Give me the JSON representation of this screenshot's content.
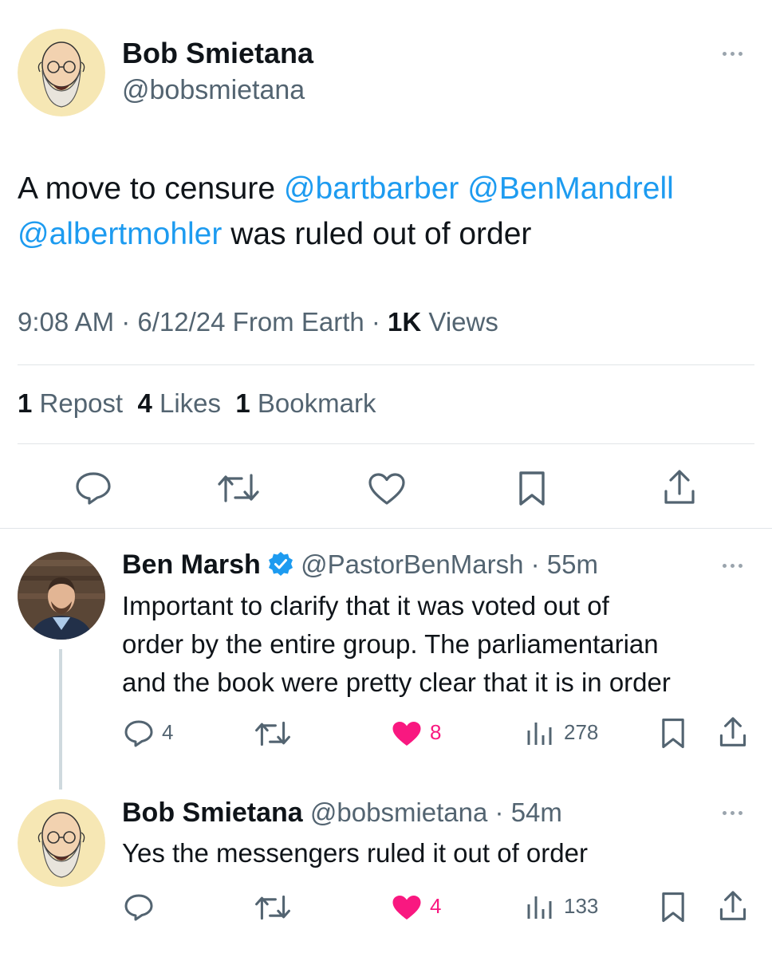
{
  "main_tweet": {
    "author_name": "Bob Smietana",
    "author_handle": "@bobsmietana",
    "text_part1": "A move to censure",
    "mention1": "@bartbarber",
    "mention2": "@BenMandrell",
    "mention3": "@albertmohler",
    "text_part2": "was ruled out of order",
    "time": "9:08 AM",
    "date_source": "6/12/24 From Earth",
    "views_count": "1K",
    "views_label": "Views",
    "repost_count": "1",
    "repost_label": "Repost",
    "likes_count": "4",
    "likes_label": "Likes",
    "bookmark_count": "1",
    "bookmark_label": "Bookmark"
  },
  "replies": [
    {
      "author_name": "Ben Marsh",
      "verified": true,
      "handle": "@PastorBenMarsh",
      "age": "55m",
      "lines": [
        "Important to clarify that it was voted out of",
        "order by the entire group. The parliamentarian",
        "and the book were pretty clear that it is in order"
      ],
      "reply_count": "4",
      "like_count": "8",
      "views_count": "278",
      "liked": true
    },
    {
      "author_name": "Bob Smietana",
      "verified": false,
      "handle": "@bobsmietana",
      "age": "54m",
      "lines": [
        "Yes the messengers ruled it out of order"
      ],
      "reply_count": "",
      "like_count": "4",
      "views_count": "133",
      "liked": true
    }
  ],
  "colors": {
    "link": "#1d9bf0",
    "like": "#f91880",
    "secondary_text": "#536471",
    "verified": "#1d9bf0"
  },
  "icons": [
    "reply-icon",
    "repost-icon",
    "like-icon",
    "bookmark-icon",
    "share-icon",
    "views-icon",
    "verified-badge-icon",
    "more-icon"
  ]
}
